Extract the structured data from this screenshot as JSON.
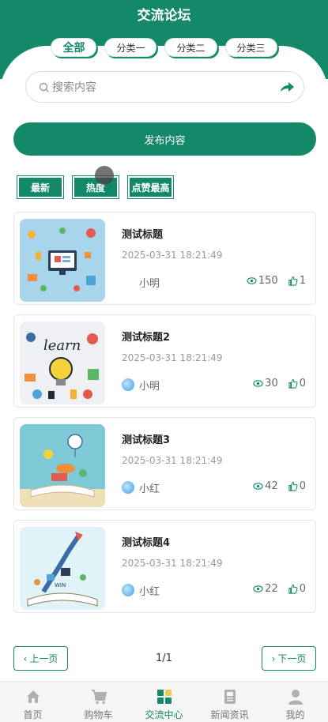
{
  "header": {
    "title": "交流论坛"
  },
  "tabs": [
    {
      "label": "全部",
      "active": true
    },
    {
      "label": "分类一",
      "active": false
    },
    {
      "label": "分类二",
      "active": false
    },
    {
      "label": "分类三",
      "active": false
    }
  ],
  "search": {
    "placeholder": "搜索内容",
    "icon": "search-icon",
    "button_icon": "arrow-right-icon"
  },
  "publish": {
    "label": "发布内容"
  },
  "sort": [
    {
      "label": "最新"
    },
    {
      "label": "热度"
    },
    {
      "label": "点赞最高"
    }
  ],
  "posts": [
    {
      "title": "测试标题",
      "time": "2025-03-31 18:21:49",
      "author": "小明",
      "views": "150",
      "likes": "1",
      "has_avatar": false,
      "image": "education-icons"
    },
    {
      "title": "测试标题2",
      "time": "2025-03-31 18:21:49",
      "author": "小明",
      "views": "30",
      "likes": "0",
      "has_avatar": true,
      "image": "learn-lightbulb"
    },
    {
      "title": "测试标题3",
      "time": "2025-03-31 18:21:49",
      "author": "小红",
      "views": "42",
      "likes": "0",
      "has_avatar": true,
      "image": "open-book-balloon"
    },
    {
      "title": "测试标题4",
      "time": "2025-03-31 18:21:49",
      "author": "小红",
      "views": "22",
      "likes": "0",
      "has_avatar": true,
      "image": "open-book-rocket"
    }
  ],
  "pager": {
    "prev": "上一页",
    "next": "下一页",
    "page": "1/1"
  },
  "nav": [
    {
      "label": "首页",
      "icon": "home-icon"
    },
    {
      "label": "购物车",
      "icon": "cart-icon"
    },
    {
      "label": "交流中心",
      "icon": "grid-icon",
      "active": true
    },
    {
      "label": "新闻资讯",
      "icon": "news-icon"
    },
    {
      "label": "我的",
      "icon": "user-icon"
    }
  ],
  "colors": {
    "primary": "#14896a"
  }
}
